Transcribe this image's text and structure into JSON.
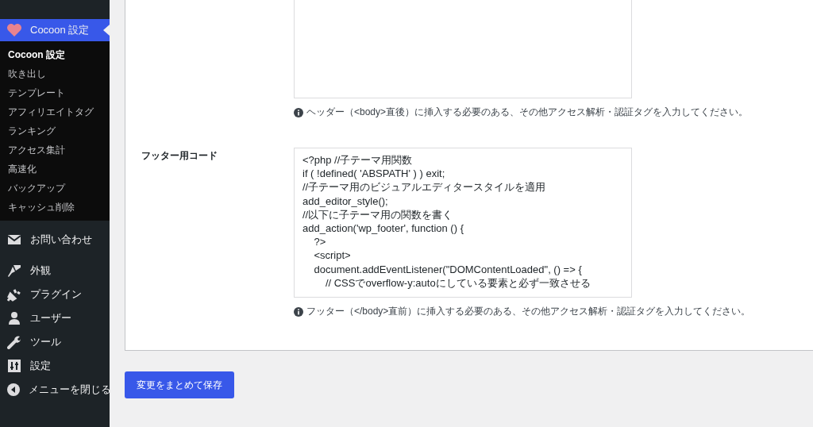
{
  "sidebar": {
    "items": [
      {
        "label": "Cocoon 設定",
        "selected": true,
        "children": [
          {
            "label": "Cocoon 設定",
            "selected": true
          },
          {
            "label": "吹き出し",
            "selected": false
          },
          {
            "label": "テンプレート",
            "selected": false
          },
          {
            "label": "アフィリエイトタグ",
            "selected": false
          },
          {
            "label": "ランキング",
            "selected": false
          },
          {
            "label": "アクセス集計",
            "selected": false
          },
          {
            "label": "高速化",
            "selected": false
          },
          {
            "label": "バックアップ",
            "selected": false
          },
          {
            "label": "キャッシュ削除",
            "selected": false
          }
        ]
      },
      {
        "label": "お問い合わせ",
        "selected": false
      },
      {
        "label": "外観",
        "selected": false
      },
      {
        "label": "プラグイン",
        "selected": false
      },
      {
        "label": "ユーザー",
        "selected": false
      },
      {
        "label": "ツール",
        "selected": false
      },
      {
        "label": "設定",
        "selected": false
      },
      {
        "label": "メニューを閉じる",
        "selected": false
      }
    ]
  },
  "settings": [
    {
      "hint": "ヘッダー（<body>直後）に挿入する必要のある、その他アクセス解析・認証タグを入力してください。"
    },
    {
      "label": "フッター用コード",
      "value": "<?php //子テーマ用関数\nif ( !defined( 'ABSPATH' ) ) exit;\n//子テーマ用のビジュアルエディタースタイルを適用\nadd_editor_style();\n//以下に子テーマ用の関数を書く\nadd_action('wp_footer', function () {\n    ?>\n    <script>\n    document.addEventListener(\"DOMContentLoaded\", () => {\n        // CSSでoverflow-y:autoにしている要素と必ず一致させる",
      "hint": "フッター（</body>直前）に挿入する必要のある、その他アクセス解析・認証タグを入力してください。"
    }
  ],
  "save_button": "変更をまとめて保存"
}
